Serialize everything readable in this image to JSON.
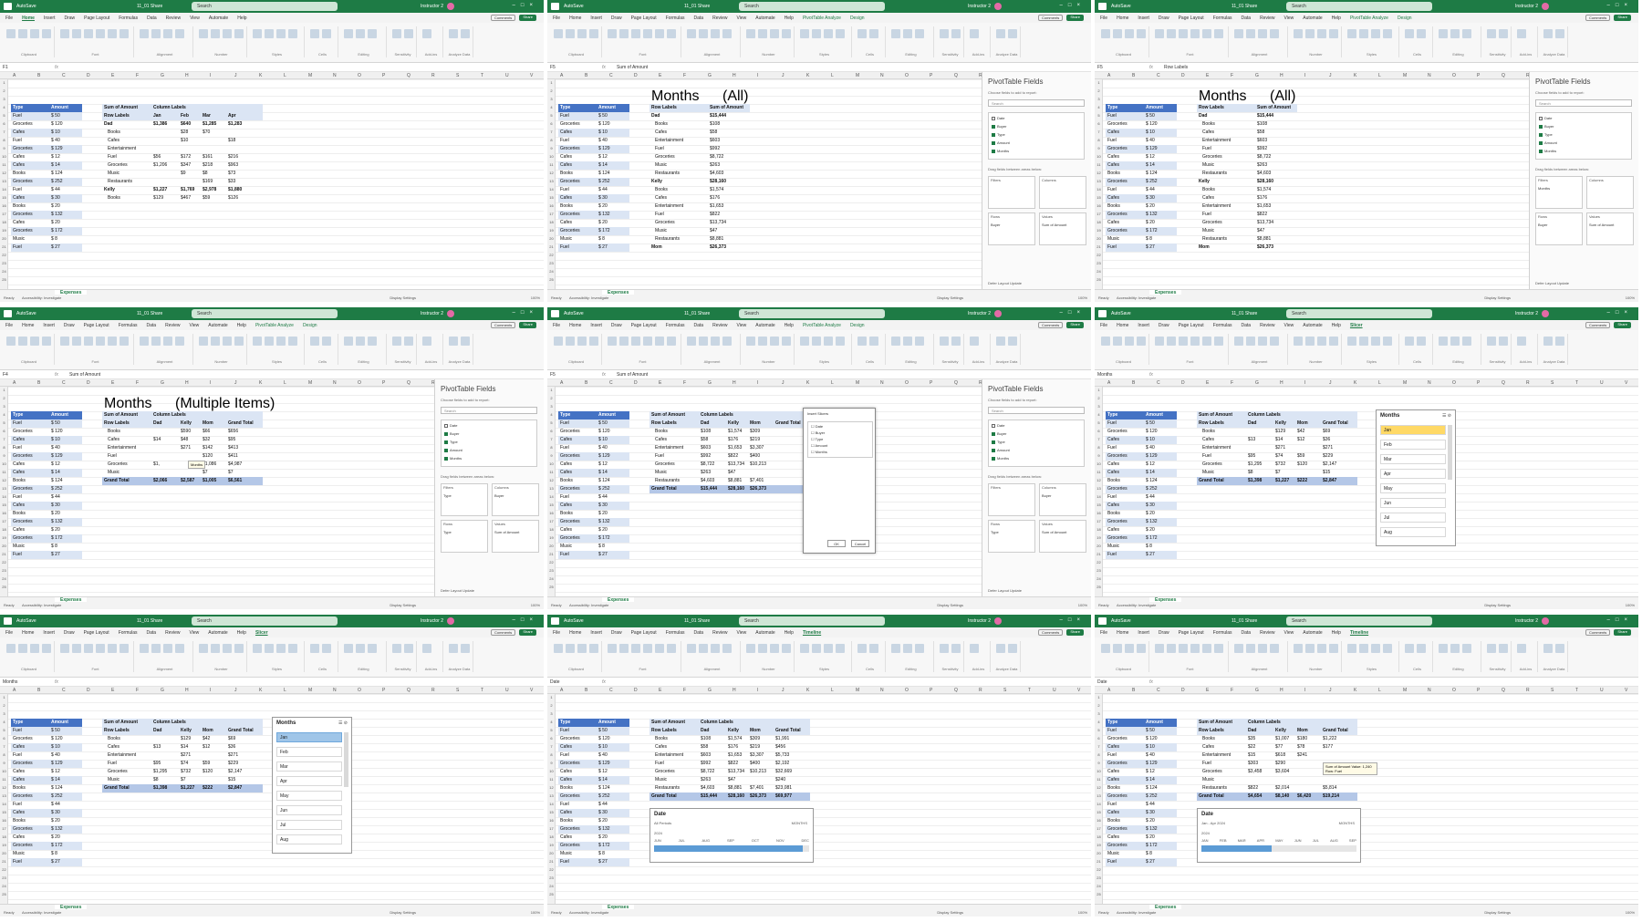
{
  "app": {
    "autosave": "AutoSave",
    "filename": "11_01 Share",
    "search": "Search",
    "user": "Instructor 2",
    "comments": "Comments",
    "share": "Share",
    "ready": "Ready",
    "accessibility": "Accessibility: Investigate",
    "display": "Display Settings",
    "zoom": "100%",
    "sheet": "Expenses",
    "accent": "#1e7b45"
  },
  "menus": {
    "home": [
      "File",
      "Home",
      "Insert",
      "Draw",
      "Page Layout",
      "Formulas",
      "Data",
      "Review",
      "View",
      "Automate",
      "Help"
    ],
    "pt": [
      "File",
      "Home",
      "Insert",
      "Draw",
      "Page Layout",
      "Formulas",
      "Data",
      "Review",
      "View",
      "Automate",
      "Help",
      "PivotTable Analyze",
      "Design"
    ],
    "slicer": [
      "File",
      "Home",
      "Insert",
      "Draw",
      "Page Layout",
      "Formulas",
      "Data",
      "Review",
      "View",
      "Automate",
      "Help",
      "Slicer"
    ],
    "timeline": [
      "File",
      "Home",
      "Insert",
      "Draw",
      "Page Layout",
      "Formulas",
      "Data",
      "Review",
      "View",
      "Automate",
      "Help",
      "Timeline"
    ]
  },
  "ribbon_groups": [
    "Clipboard",
    "Font",
    "Alignment",
    "Number",
    "Styles",
    "Cells",
    "Editing",
    "Sensitivity",
    "Add-ins",
    "Analyze Data"
  ],
  "source_table": {
    "headers": [
      "Type",
      "Amount"
    ],
    "rows": [
      [
        "Fuel",
        "50"
      ],
      [
        "Groceries",
        "120"
      ],
      [
        "Cafes",
        "10"
      ],
      [
        "Fuel",
        "40"
      ],
      [
        "Groceries",
        "129"
      ],
      [
        "Cafes",
        "12"
      ],
      [
        "Cafes",
        "14"
      ],
      [
        "Books",
        "124"
      ],
      [
        "Groceries",
        "252"
      ],
      [
        "Fuel",
        "44"
      ],
      [
        "Cafes",
        "30"
      ],
      [
        "Books",
        "20"
      ],
      [
        "Groceries",
        "132"
      ],
      [
        "Cafes",
        "20"
      ],
      [
        "Groceries",
        "172"
      ],
      [
        "Music",
        "8"
      ],
      [
        "Fuel",
        "27"
      ]
    ]
  },
  "panels": [
    {
      "menu": "home",
      "namebox": "F1",
      "formula": "",
      "pivot": {
        "rows": [
          [
            "Sum of Amount",
            "Column Labels",
            "",
            "",
            ""
          ],
          [
            "Row Labels",
            "Jan",
            "Feb",
            "Mar",
            "Apr"
          ],
          [
            "Dad",
            "$1,386",
            "$640",
            "$1,285",
            "$1,283"
          ],
          [
            "Books",
            "",
            "$28",
            "$70",
            ""
          ],
          [
            "Cafes",
            "",
            "$10",
            "",
            "$18"
          ],
          [
            "Entertainment",
            "",
            "",
            "",
            ""
          ],
          [
            "Fuel",
            "$56",
            "$172",
            "$161",
            "$216"
          ],
          [
            "Groceries",
            "$1,206",
            "$347",
            "$218",
            "$963"
          ],
          [
            "Music",
            "",
            "$9",
            "$8",
            "$73"
          ],
          [
            "Restaurants",
            "",
            "",
            "$169",
            "$33"
          ],
          [
            "Kelly",
            "$1,227",
            "$1,769",
            "$2,978",
            "$1,880"
          ],
          [
            "Books",
            "$129",
            "$467",
            "$59",
            "$126"
          ]
        ]
      }
    },
    {
      "menu": "pt",
      "namebox": "F5",
      "formula": "Sum of Amount",
      "filter": [
        "Months",
        "(All)"
      ],
      "pivot": {
        "rows": [
          [
            "Row Labels",
            "Sum of Amount"
          ],
          [
            "Dad",
            "$15,444"
          ],
          [
            "Books",
            "$108"
          ],
          [
            "Cafes",
            "$58"
          ],
          [
            "Entertainment",
            "$603"
          ],
          [
            "Fuel",
            "$992"
          ],
          [
            "Groceries",
            "$8,722"
          ],
          [
            "Music",
            "$263"
          ],
          [
            "Restaurants",
            "$4,603"
          ],
          [
            "Kelly",
            "$28,160"
          ],
          [
            "Books",
            "$1,574"
          ],
          [
            "Cafes",
            "$176"
          ],
          [
            "Entertainment",
            "$1,653"
          ],
          [
            "Fuel",
            "$822"
          ],
          [
            "Groceries",
            "$13,734"
          ],
          [
            "Music",
            "$47"
          ],
          [
            "Restaurants",
            "$8,881"
          ],
          [
            "Mom",
            "$26,373"
          ]
        ]
      },
      "fields": [
        "Date",
        "Buyer",
        "Type",
        "Amount",
        "Months"
      ],
      "fields_checked": [
        false,
        true,
        true,
        true,
        true
      ],
      "pane": {
        "title": "PivotTable Fields",
        "sub": "Choose fields to add to report:",
        "search": "Search",
        "drag": "Drag fields between areas below:",
        "filters": "Filters",
        "columns": "Columns",
        "rows_label": "Rows",
        "values": "Values",
        "filters_v": "",
        "columns_v": "",
        "rows_v": "Buyer",
        "values_v": "Sum of Amount",
        "defer": "Defer Layout Update"
      }
    },
    {
      "menu": "pt",
      "namebox": "F5",
      "formula": "Row Labels",
      "filter": [
        "Months",
        "(All)"
      ],
      "pivot": {
        "rows": [
          [
            "Row Labels",
            "Sum of Amount"
          ],
          [
            "Dad",
            "$15,444"
          ],
          [
            "Books",
            "$108"
          ],
          [
            "Cafes",
            "$58"
          ],
          [
            "Entertainment",
            "$603"
          ],
          [
            "Fuel",
            "$992"
          ],
          [
            "Groceries",
            "$8,722"
          ],
          [
            "Music",
            "$263"
          ],
          [
            "Restaurants",
            "$4,603"
          ],
          [
            "Kelly",
            "$28,160"
          ],
          [
            "Books",
            "$1,574"
          ],
          [
            "Cafes",
            "$176"
          ],
          [
            "Entertainment",
            "$1,653"
          ],
          [
            "Fuel",
            "$822"
          ],
          [
            "Groceries",
            "$13,734"
          ],
          [
            "Music",
            "$47"
          ],
          [
            "Restaurants",
            "$8,881"
          ],
          [
            "Mom",
            "$26,373"
          ]
        ]
      },
      "fields": [
        "Date",
        "Buyer",
        "Type",
        "Amount",
        "Months"
      ],
      "fields_checked": [
        false,
        true,
        true,
        true,
        true
      ],
      "pane": {
        "title": "PivotTable Fields",
        "sub": "Choose fields to add to report:",
        "search": "Search",
        "drag": "Drag fields between areas below:",
        "filters": "Filters",
        "columns": "Columns",
        "rows_label": "Rows",
        "values": "Values",
        "filters_v": "Months",
        "columns_v": "",
        "rows_v": "Buyer",
        "values_v": "Sum of Amount",
        "defer": "Defer Layout Update"
      }
    },
    {
      "menu": "pt",
      "namebox": "F4",
      "formula": "Sum of Amount",
      "filter": [
        "Months",
        "(Multiple Items)"
      ],
      "pivot": {
        "rows": [
          [
            "Sum of Amount",
            "Column Labels",
            "",
            "",
            ""
          ],
          [
            "Row Labels",
            "Dad",
            "Kelly",
            "Mom",
            "Grand Total"
          ],
          [
            "Books",
            "",
            "$590",
            "$66",
            "$656"
          ],
          [
            "Cafes",
            "$14",
            "$48",
            "$32",
            "$95"
          ],
          [
            "Entertainment",
            "",
            "$271",
            "$142",
            "$413"
          ],
          [
            "Fuel",
            "",
            "",
            "$120",
            "$411"
          ],
          [
            "Groceries",
            "$1,",
            "",
            "$1,086",
            "$4,987"
          ],
          [
            "Music",
            "",
            "",
            "$7",
            "$7"
          ],
          [
            "Grand Total",
            "$2,066",
            "$2,587",
            "$1,005",
            "$6,561"
          ]
        ]
      },
      "hover": "Months",
      "fields": [
        "Date",
        "Buyer",
        "Type",
        "Amount",
        "Months"
      ],
      "fields_checked": [
        false,
        true,
        true,
        true,
        true
      ],
      "pane": {
        "title": "PivotTable Fields",
        "sub": "Choose fields to add to report:",
        "search": "Search",
        "drag": "Drag fields between areas below:",
        "filters": "Filters",
        "columns": "Columns",
        "rows_label": "Rows",
        "values": "Values",
        "filters_v": "Type",
        "columns_v": "Buyer",
        "rows_v": "Type",
        "values_v": "Sum of Amount",
        "defer": "Defer Layout Update"
      }
    },
    {
      "menu": "pt",
      "namebox": "F5",
      "formula": "Sum of Amount",
      "pivot": {
        "rows": [
          [
            "Sum of Amount",
            "Column Labels",
            "",
            "",
            ""
          ],
          [
            "Row Labels",
            "Dad",
            "Kelly",
            "Mom",
            "Grand Total"
          ],
          [
            "Books",
            "$108",
            "$1,574",
            "$309",
            ""
          ],
          [
            "Cafes",
            "$58",
            "$176",
            "$219",
            ""
          ],
          [
            "Entertainment",
            "$603",
            "$1,653",
            "$3,307",
            ""
          ],
          [
            "Fuel",
            "$992",
            "$822",
            "$400",
            ""
          ],
          [
            "Groceries",
            "$8,722",
            "$13,734",
            "$10,213",
            ""
          ],
          [
            "Music",
            "$263",
            "$47",
            "",
            ""
          ],
          [
            "Restaurants",
            "$4,603",
            "$8,881",
            "$7,401",
            ""
          ],
          [
            "Grand Total",
            "$15,444",
            "$28,160",
            "$26,373",
            ""
          ]
        ]
      },
      "dialog": {
        "title": "Insert Slicers",
        "items": [
          "Date",
          "Buyer",
          "Type",
          "Amount",
          "Months"
        ],
        "ok": "OK",
        "cancel": "Cancel"
      },
      "fields": [
        "Date",
        "Buyer",
        "Type",
        "Amount",
        "Months"
      ],
      "fields_checked": [
        false,
        true,
        true,
        true,
        true
      ],
      "pane": {
        "title": "PivotTable Fields",
        "sub": "Choose fields to add to report:",
        "search": "Search",
        "drag": "Drag fields between areas below:",
        "filters": "Filters",
        "columns": "Columns",
        "rows_label": "Rows",
        "values": "Values",
        "filters_v": "",
        "columns_v": "Buyer",
        "rows_v": "Type",
        "values_v": "Sum of Amount",
        "defer": "Defer Layout Update"
      }
    },
    {
      "menu": "slicer",
      "namebox": "Months",
      "formula": "",
      "pivot": {
        "rows": [
          [
            "Sum of Amount",
            "Column Labels",
            "",
            "",
            ""
          ],
          [
            "Row Labels",
            "Dad",
            "Kelly",
            "Mom",
            "Grand Total"
          ],
          [
            "Books",
            "",
            "$129",
            "$42",
            "$69"
          ],
          [
            "Cafes",
            "$13",
            "$14",
            "$12",
            "$36"
          ],
          [
            "Entertainment",
            "",
            "$271",
            "",
            "$271"
          ],
          [
            "Fuel",
            "$95",
            "$74",
            "$59",
            "$229"
          ],
          [
            "Groceries",
            "$1,295",
            "$732",
            "$120",
            "$2,147"
          ],
          [
            "Music",
            "$8",
            "$7",
            "",
            "$15"
          ],
          [
            "Grand Total",
            "$1,398",
            "$1,227",
            "$222",
            "$2,847"
          ]
        ]
      },
      "slicer": {
        "title": "Months",
        "items": [
          "Jan",
          "Feb",
          "Mar",
          "Apr",
          "May",
          "Jun",
          "Jul",
          "Aug"
        ],
        "selected": 0
      }
    },
    {
      "menu": "slicer",
      "namebox": "Months",
      "formula": "",
      "pivot": {
        "rows": [
          [
            "Sum of Amount",
            "Column Labels",
            "",
            "",
            ""
          ],
          [
            "Row Labels",
            "Dad",
            "Kelly",
            "Mom",
            "Grand Total"
          ],
          [
            "Books",
            "",
            "$129",
            "$42",
            "$69"
          ],
          [
            "Cafes",
            "$13",
            "$14",
            "$12",
            "$36"
          ],
          [
            "Entertainment",
            "",
            "$271",
            "",
            "$271"
          ],
          [
            "Fuel",
            "$95",
            "$74",
            "$59",
            "$229"
          ],
          [
            "Groceries",
            "$1,295",
            "$732",
            "$120",
            "$2,147"
          ],
          [
            "Music",
            "$8",
            "$7",
            "",
            "$15"
          ],
          [
            "Grand Total",
            "$1,398",
            "$1,227",
            "$222",
            "$2,847"
          ]
        ]
      },
      "slicer": {
        "title": "Months",
        "items": [
          "Jan",
          "Feb",
          "Mar",
          "Apr",
          "May",
          "Jun",
          "Jul",
          "Aug"
        ],
        "selected": 0
      }
    },
    {
      "menu": "timeline",
      "namebox": "Date",
      "formula": "",
      "pivot": {
        "rows": [
          [
            "Sum of Amount",
            "Column Labels",
            "",
            "",
            ""
          ],
          [
            "Row Labels",
            "Dad",
            "Kelly",
            "Mom",
            "Grand Total"
          ],
          [
            "Books",
            "$108",
            "$1,574",
            "$309",
            "$1,991"
          ],
          [
            "Cafes",
            "$58",
            "$176",
            "$219",
            "$456"
          ],
          [
            "Entertainment",
            "$603",
            "$1,653",
            "$3,307",
            "$5,733"
          ],
          [
            "Fuel",
            "$992",
            "$822",
            "$400",
            "$2,192"
          ],
          [
            "Groceries",
            "$8,722",
            "$13,734",
            "$10,213",
            "$32,669"
          ],
          [
            "Music",
            "$263",
            "$47",
            "",
            "$240"
          ],
          [
            "Restaurants",
            "$4,603",
            "$8,881",
            "$7,401",
            "$23,081"
          ],
          [
            "Grand Total",
            "$15,444",
            "$28,160",
            "$26,373",
            "$69,977"
          ]
        ]
      },
      "timeline": {
        "title": "Date",
        "range": "All Periods",
        "level": "MONTHS",
        "year": "2024",
        "months": [
          "JUN",
          "JUL",
          "AUG",
          "SEP",
          "OCT",
          "NOV",
          "DEC"
        ],
        "fill": 0.95
      }
    },
    {
      "menu": "timeline",
      "namebox": "Date",
      "formula": "",
      "pivot": {
        "rows": [
          [
            "Sum of Amount",
            "Column Labels",
            "",
            "",
            ""
          ],
          [
            "Row Labels",
            "Dad",
            "Kelly",
            "Mom",
            "Grand Total"
          ],
          [
            "Books",
            "$35",
            "$1,007",
            "$180",
            "$1,222"
          ],
          [
            "Cafes",
            "$22",
            "$77",
            "$78",
            "$177"
          ],
          [
            "Entertainment",
            "$15",
            "$618",
            "$241",
            ""
          ],
          [
            "Fuel",
            "$303",
            "$290",
            "",
            ""
          ],
          [
            "Groceries",
            "$3,458",
            "$3,604",
            "",
            "$9,388"
          ],
          [
            "Music",
            "",
            "",
            "",
            ""
          ],
          [
            "Restaurants",
            "$822",
            "$2,014",
            "",
            "$5,814"
          ],
          [
            "Grand Total",
            "$4,654",
            "$8,140",
            "$6,420",
            "$19,214"
          ]
        ]
      },
      "tooltip": "Sum of Amount Value: 1,240 Row: Fuel",
      "timeline": {
        "title": "Date",
        "range": "Jan - Apr 2024",
        "level": "MONTHS",
        "year": "2024",
        "months": [
          "JAN",
          "FEB",
          "MAR",
          "APR",
          "MAY",
          "JUN",
          "JUL",
          "AUG",
          "SEP"
        ],
        "fill": 0.45
      }
    }
  ]
}
